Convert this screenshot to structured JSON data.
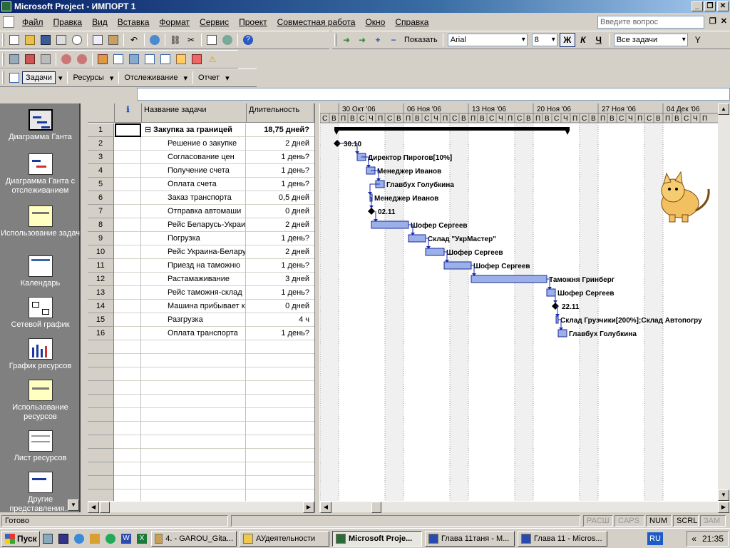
{
  "window": {
    "title": "Microsoft Project - ИМПОРТ 1"
  },
  "menu": {
    "items": [
      "Файл",
      "Правка",
      "Вид",
      "Вставка",
      "Формат",
      "Сервис",
      "Проект",
      "Совместная работа",
      "Окно",
      "Справка"
    ],
    "ask_placeholder": "Введите вопрос"
  },
  "toolbar": {
    "show_label": "Показать",
    "font": "Arial",
    "font_size": "8",
    "bold": "Ж",
    "italic": "К",
    "underline": "Ч",
    "filter": "Все задачи"
  },
  "view_toolbar": {
    "tasks": "Задачи",
    "resources": "Ресурсы",
    "tracking": "Отслеживание",
    "report": "Отчет"
  },
  "viewbar": {
    "items": [
      "Диаграмма Ганта",
      "Диаграмма Ганта с отслеживанием",
      "Использование задач",
      "Календарь",
      "Сетевой график",
      "График ресурсов",
      "Использование ресурсов",
      "Лист ресурсов",
      "Другие представления..."
    ]
  },
  "table": {
    "headers": {
      "info": "ℹ",
      "name": "Название задачи",
      "duration": "Длительность"
    },
    "rows": [
      {
        "n": "1",
        "name": "Закупка за границей",
        "dur": "18,75 дней?",
        "summary": true
      },
      {
        "n": "2",
        "name": "Решение о закупке",
        "dur": "2 дней"
      },
      {
        "n": "3",
        "name": "Согласование цен",
        "dur": "1 день?"
      },
      {
        "n": "4",
        "name": "Получение счета",
        "dur": "1 день?"
      },
      {
        "n": "5",
        "name": "Оплата счета",
        "dur": "1 день?"
      },
      {
        "n": "6",
        "name": "Заказ транспорта",
        "dur": "0,5 дней"
      },
      {
        "n": "7",
        "name": "Отправка автомаши",
        "dur": "0 дней"
      },
      {
        "n": "8",
        "name": "Рейс Беларусь-Украи",
        "dur": "2 дней"
      },
      {
        "n": "9",
        "name": "Погрузка",
        "dur": "1 день?"
      },
      {
        "n": "10",
        "name": "Рейс Украина-Белару",
        "dur": "2 дней"
      },
      {
        "n": "11",
        "name": "Приезд на таможню",
        "dur": "1 день?"
      },
      {
        "n": "12",
        "name": "Растамаживание",
        "dur": "3 дней"
      },
      {
        "n": "13",
        "name": "Рейс таможня-склад",
        "dur": "1 день?"
      },
      {
        "n": "14",
        "name": "Машина прибывает к",
        "dur": "0 дней"
      },
      {
        "n": "15",
        "name": "Разгрузка",
        "dur": "4 ч"
      },
      {
        "n": "16",
        "name": "Оплата транспорта",
        "dur": "1 день?"
      }
    ]
  },
  "gantt": {
    "weeks": [
      "30 Окт '06",
      "06 Ноя '06",
      "13 Ноя '06",
      "20 Ноя '06",
      "27 Ноя '06",
      "04 Дек '06"
    ],
    "days": [
      "С",
      "В",
      "П",
      "В",
      "С",
      "Ч",
      "П",
      "С",
      "В",
      "П",
      "В",
      "С",
      "Ч",
      "П",
      "С",
      "В",
      "П",
      "В",
      "С",
      "Ч",
      "П",
      "С",
      "В",
      "П",
      "В",
      "С",
      "Ч",
      "П",
      "С",
      "В",
      "П",
      "В",
      "С",
      "Ч",
      "П",
      "С",
      "В",
      "П",
      "В",
      "С",
      "Ч",
      "П"
    ],
    "labels": [
      "30.10",
      "Директор Пирогов[10%]",
      "Менеджер Иванов",
      "Главбух Голубкина",
      "Менеджер Иванов",
      "02.11",
      "Шофер Сергеев",
      "Склад \"УкрМастер\"",
      "Шофер Сергеев",
      "Шофер Сергеев",
      "Таможня Гринберг",
      "Шофер Сергеев",
      "22.11",
      "Склад Грузчики[200%];Склад Автопогру",
      "Главбух Голубкина"
    ]
  },
  "status": {
    "ready": "Готово",
    "caps_ext": "РАСШ",
    "caps": "CAPS",
    "num": "NUM",
    "scrl": "SCRL",
    "zam": "ЗАМ"
  },
  "taskbar": {
    "start": "Пуск",
    "tasks": [
      "4. - GAROU_Gita...",
      "АУдеятельности",
      "Microsoft Proje...",
      "Глава 11таня - М...",
      "Глава 11 - Micros..."
    ],
    "lang": "RU",
    "clock": "21:35"
  }
}
